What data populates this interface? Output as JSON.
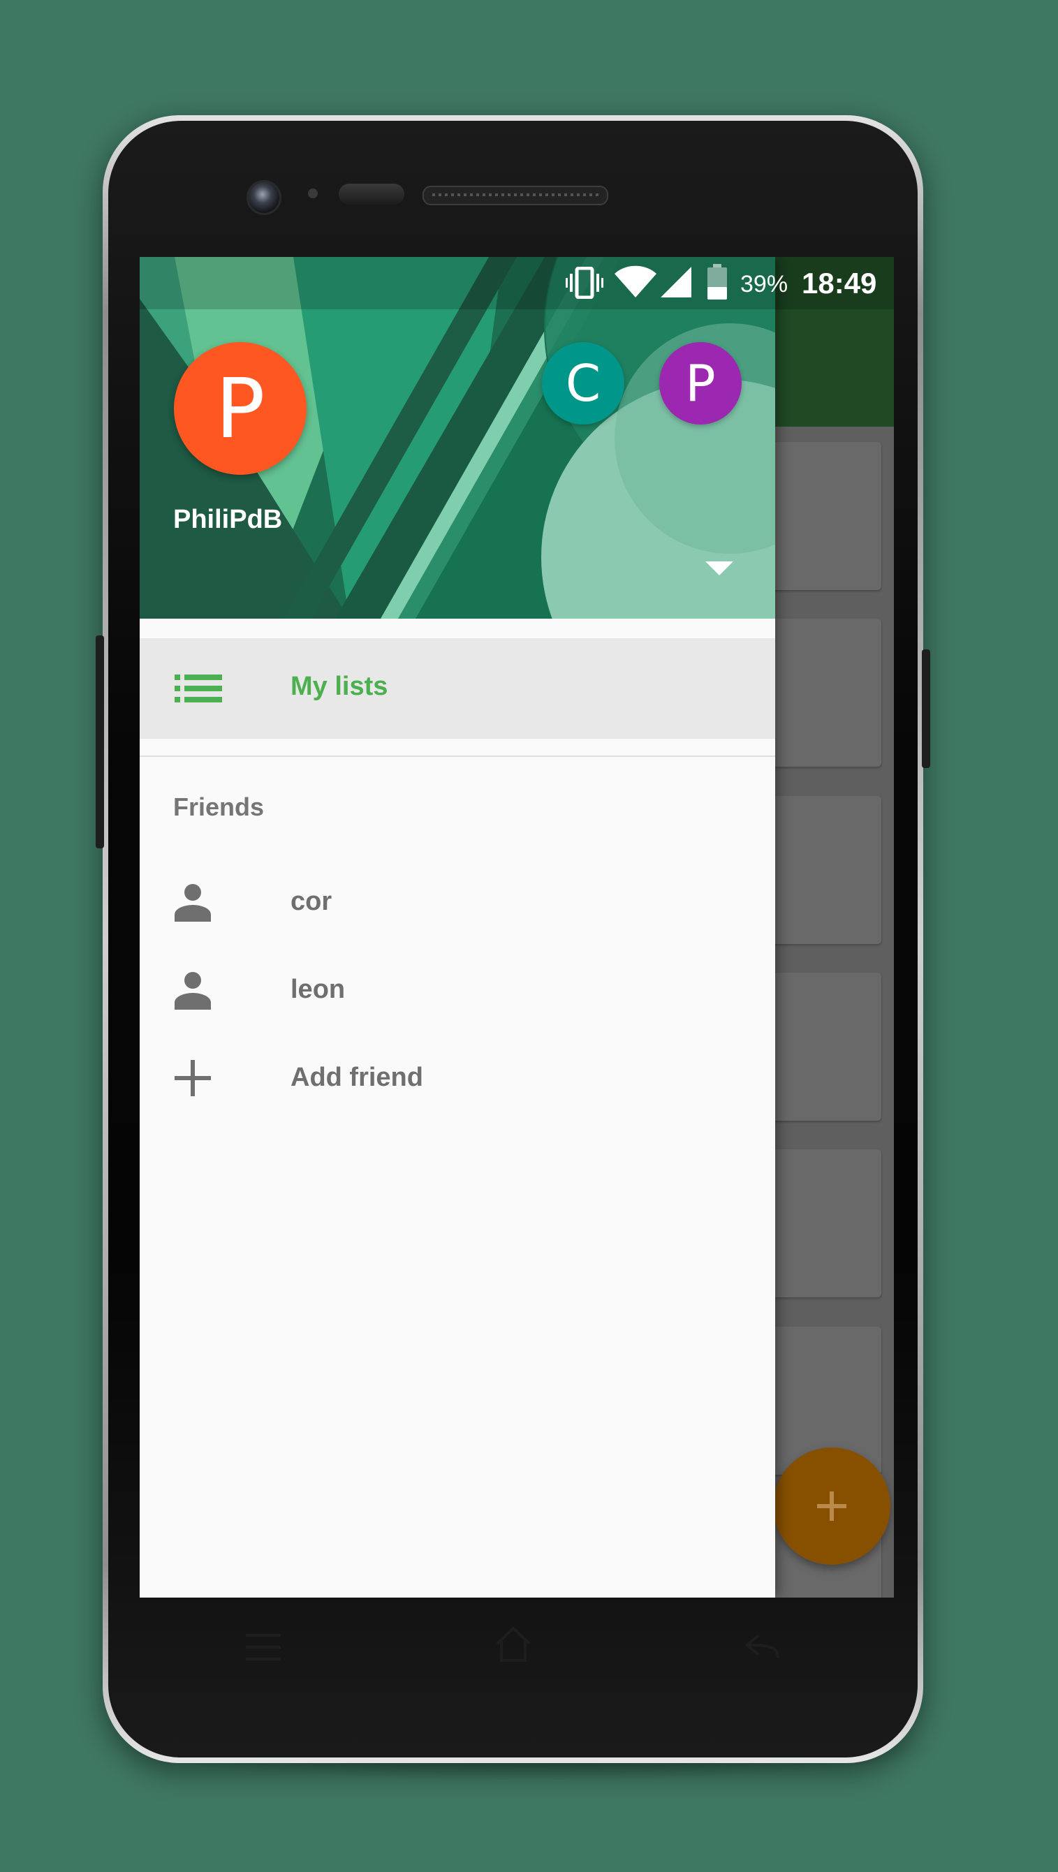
{
  "device": {
    "frame_color": "#c8c8c8",
    "body_color": "#050505"
  },
  "status_bar": {
    "icons": [
      "vibrate-icon",
      "wifi-icon",
      "signal-icon",
      "battery-icon"
    ],
    "battery_percent": "39%",
    "time": "18:49"
  },
  "drawer": {
    "account": {
      "initial": "P",
      "name": "PhiliPdB",
      "color": "#ff5722"
    },
    "other_accounts": [
      {
        "initial": "C",
        "color": "#00968a"
      },
      {
        "initial": "P",
        "color": "#9c27b0"
      }
    ],
    "dropdown_icon": "arrow-drop-down-icon",
    "primary_item": {
      "label": "My lists",
      "icon": "list-icon",
      "color": "#4caf50"
    },
    "friends_section": {
      "title": "Friends",
      "items": [
        {
          "label": "cor",
          "icon": "person-icon"
        },
        {
          "label": "leon",
          "icon": "person-icon"
        },
        {
          "label": "Add friend",
          "icon": "add-icon"
        }
      ]
    }
  },
  "background_app": {
    "toolbar_color": "#1f4a24",
    "fab_icon": "add-icon",
    "fab_color": "#ff9800"
  },
  "system_nav": {
    "buttons": [
      "menu-icon",
      "home-icon",
      "back-icon"
    ]
  }
}
